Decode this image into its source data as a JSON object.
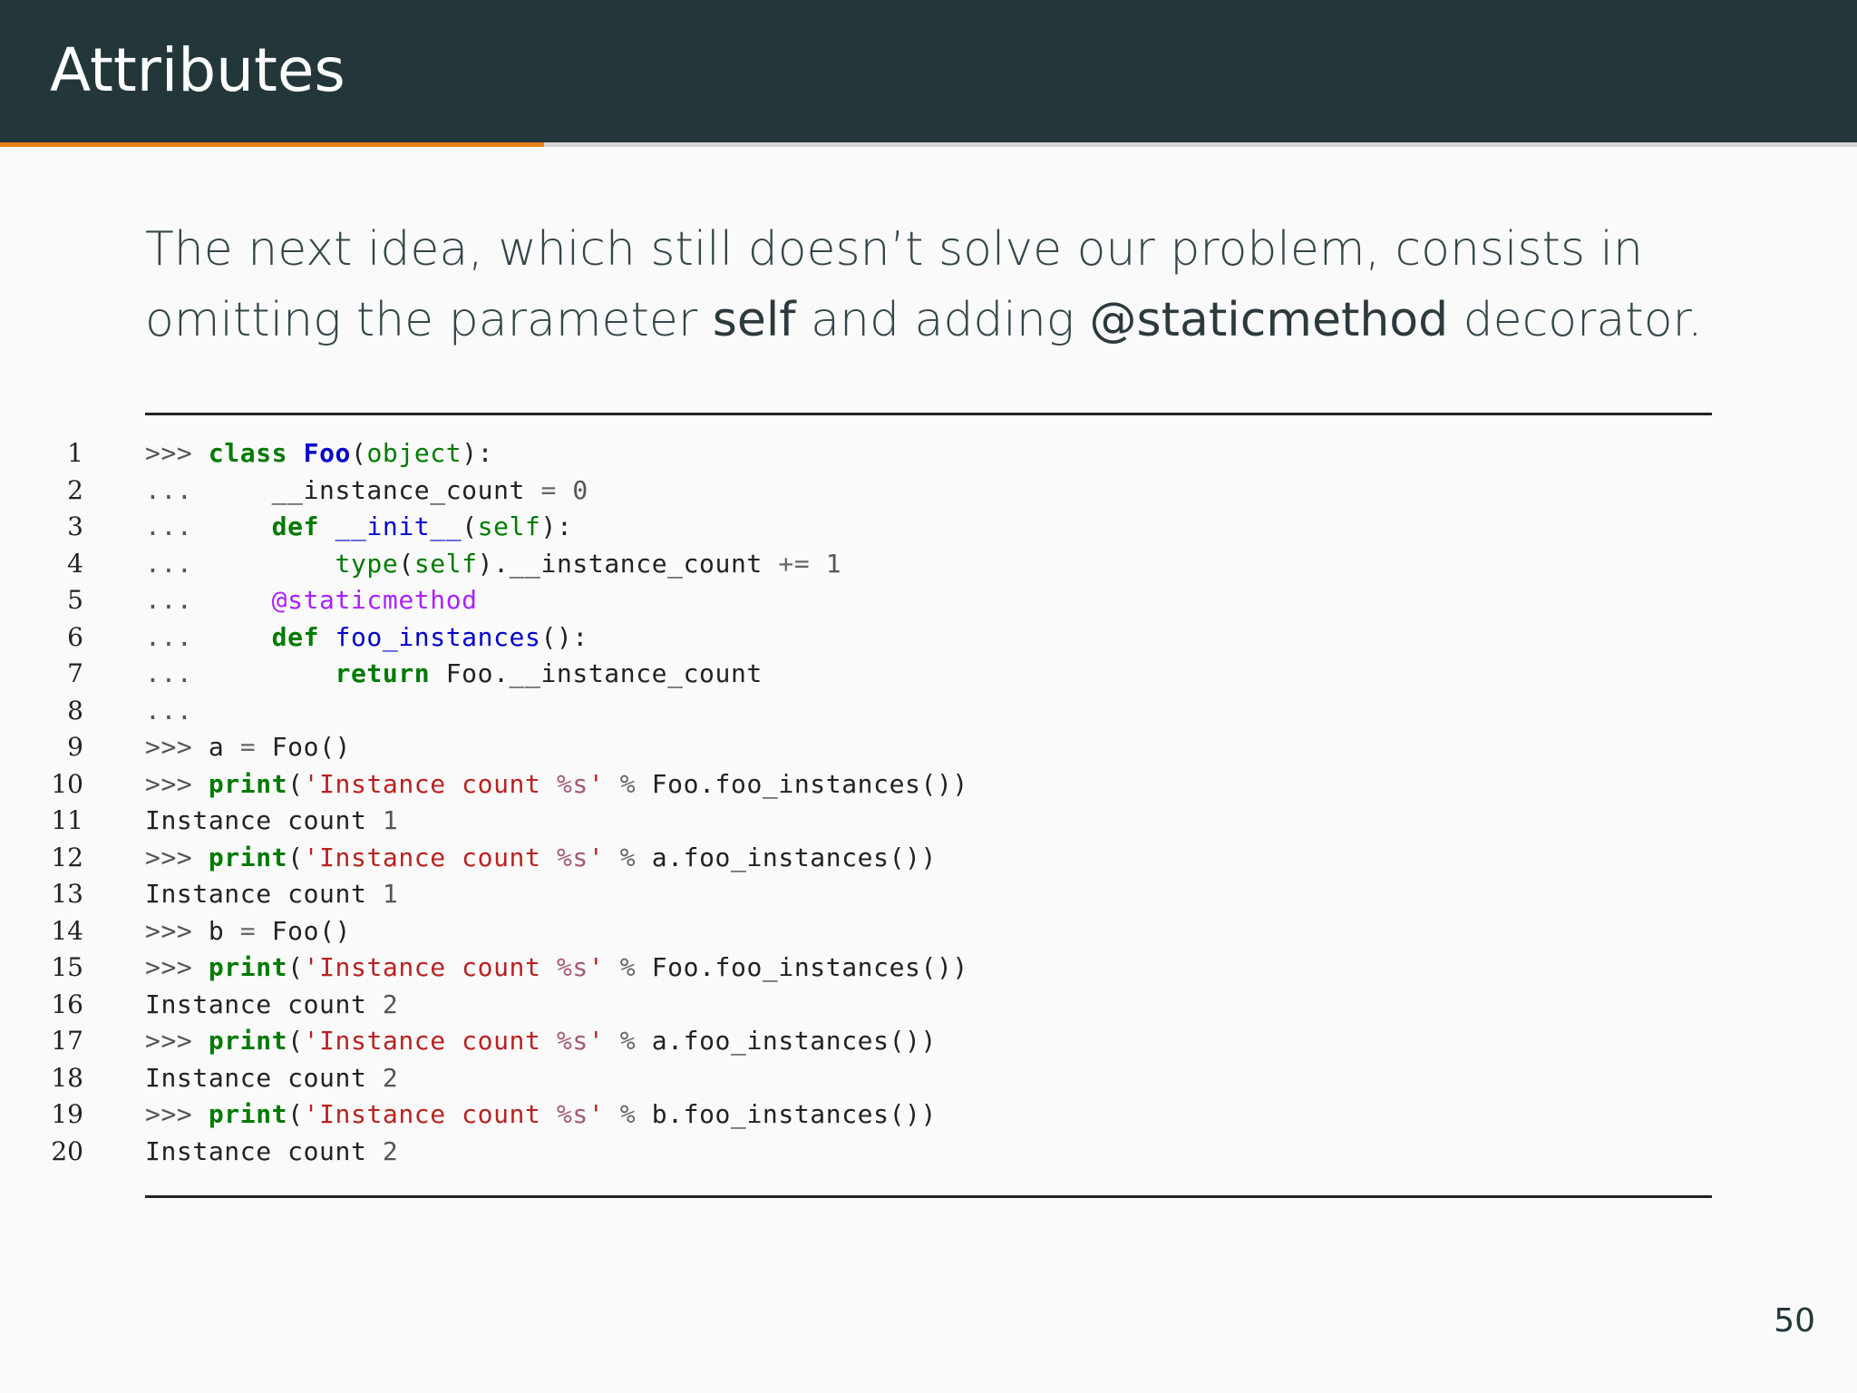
{
  "slide": {
    "title": "Attributes",
    "progress": 0.293,
    "page_number": "50",
    "intro": {
      "part1": "The next idea, which still doesn’t solve our problem, consists in omitting the parameter ",
      "kw1": "self",
      "part2": " and adding ",
      "kw2": "@staticmethod",
      "part3": " decorator."
    }
  },
  "code": {
    "lines": [
      {
        "n": "1",
        "tokens": [
          {
            "t": ">>> ",
            "c": "prompt"
          },
          {
            "t": "class",
            "c": "kw"
          },
          {
            "t": " ",
            "c": "plain"
          },
          {
            "t": "Foo",
            "c": "cls"
          },
          {
            "t": "(",
            "c": "plain"
          },
          {
            "t": "object",
            "c": "bi"
          },
          {
            "t": "):",
            "c": "plain"
          }
        ]
      },
      {
        "n": "2",
        "tokens": [
          {
            "t": "...     ",
            "c": "prompt"
          },
          {
            "t": "__instance_count ",
            "c": "plain"
          },
          {
            "t": "=",
            "c": "op"
          },
          {
            "t": " ",
            "c": "plain"
          },
          {
            "t": "0",
            "c": "num"
          }
        ]
      },
      {
        "n": "3",
        "tokens": [
          {
            "t": "...     ",
            "c": "prompt"
          },
          {
            "t": "def",
            "c": "kw"
          },
          {
            "t": " ",
            "c": "plain"
          },
          {
            "t": "__init__",
            "c": "fn"
          },
          {
            "t": "(",
            "c": "plain"
          },
          {
            "t": "self",
            "c": "bi"
          },
          {
            "t": "):",
            "c": "plain"
          }
        ]
      },
      {
        "n": "4",
        "tokens": [
          {
            "t": "...         ",
            "c": "prompt"
          },
          {
            "t": "type",
            "c": "bi"
          },
          {
            "t": "(",
            "c": "plain"
          },
          {
            "t": "self",
            "c": "bi"
          },
          {
            "t": ").__instance_count ",
            "c": "plain"
          },
          {
            "t": "+=",
            "c": "op"
          },
          {
            "t": " ",
            "c": "plain"
          },
          {
            "t": "1",
            "c": "num"
          }
        ]
      },
      {
        "n": "5",
        "tokens": [
          {
            "t": "...     ",
            "c": "prompt"
          },
          {
            "t": "@staticmethod",
            "c": "deco"
          }
        ]
      },
      {
        "n": "6",
        "tokens": [
          {
            "t": "...     ",
            "c": "prompt"
          },
          {
            "t": "def",
            "c": "kw"
          },
          {
            "t": " ",
            "c": "plain"
          },
          {
            "t": "foo_instances",
            "c": "fn"
          },
          {
            "t": "():",
            "c": "plain"
          }
        ]
      },
      {
        "n": "7",
        "tokens": [
          {
            "t": "...         ",
            "c": "prompt"
          },
          {
            "t": "return",
            "c": "kw"
          },
          {
            "t": " Foo.__instance_count",
            "c": "plain"
          }
        ]
      },
      {
        "n": "8",
        "tokens": [
          {
            "t": "...",
            "c": "prompt"
          }
        ]
      },
      {
        "n": "9",
        "tokens": [
          {
            "t": ">>> ",
            "c": "prompt"
          },
          {
            "t": "a ",
            "c": "plain"
          },
          {
            "t": "=",
            "c": "op"
          },
          {
            "t": " Foo()",
            "c": "plain"
          }
        ]
      },
      {
        "n": "10",
        "tokens": [
          {
            "t": ">>> ",
            "c": "prompt"
          },
          {
            "t": "print",
            "c": "kw"
          },
          {
            "t": "(",
            "c": "plain"
          },
          {
            "t": "'Instance count ",
            "c": "str"
          },
          {
            "t": "%s",
            "c": "fmt"
          },
          {
            "t": "'",
            "c": "str"
          },
          {
            "t": " ",
            "c": "plain"
          },
          {
            "t": "%",
            "c": "op"
          },
          {
            "t": " Foo.foo_instances())",
            "c": "plain"
          }
        ]
      },
      {
        "n": "11",
        "tokens": [
          {
            "t": "Instance count ",
            "c": "plain"
          },
          {
            "t": "1",
            "c": "num"
          }
        ]
      },
      {
        "n": "12",
        "tokens": [
          {
            "t": ">>> ",
            "c": "prompt"
          },
          {
            "t": "print",
            "c": "kw"
          },
          {
            "t": "(",
            "c": "plain"
          },
          {
            "t": "'Instance count ",
            "c": "str"
          },
          {
            "t": "%s",
            "c": "fmt"
          },
          {
            "t": "'",
            "c": "str"
          },
          {
            "t": " ",
            "c": "plain"
          },
          {
            "t": "%",
            "c": "op"
          },
          {
            "t": " a.foo_instances())",
            "c": "plain"
          }
        ]
      },
      {
        "n": "13",
        "tokens": [
          {
            "t": "Instance count ",
            "c": "plain"
          },
          {
            "t": "1",
            "c": "num"
          }
        ]
      },
      {
        "n": "14",
        "tokens": [
          {
            "t": ">>> ",
            "c": "prompt"
          },
          {
            "t": "b ",
            "c": "plain"
          },
          {
            "t": "=",
            "c": "op"
          },
          {
            "t": " Foo()",
            "c": "plain"
          }
        ]
      },
      {
        "n": "15",
        "tokens": [
          {
            "t": ">>> ",
            "c": "prompt"
          },
          {
            "t": "print",
            "c": "kw"
          },
          {
            "t": "(",
            "c": "plain"
          },
          {
            "t": "'Instance count ",
            "c": "str"
          },
          {
            "t": "%s",
            "c": "fmt"
          },
          {
            "t": "'",
            "c": "str"
          },
          {
            "t": " ",
            "c": "plain"
          },
          {
            "t": "%",
            "c": "op"
          },
          {
            "t": " Foo.foo_instances())",
            "c": "plain"
          }
        ]
      },
      {
        "n": "16",
        "tokens": [
          {
            "t": "Instance count ",
            "c": "plain"
          },
          {
            "t": "2",
            "c": "num"
          }
        ]
      },
      {
        "n": "17",
        "tokens": [
          {
            "t": ">>> ",
            "c": "prompt"
          },
          {
            "t": "print",
            "c": "kw"
          },
          {
            "t": "(",
            "c": "plain"
          },
          {
            "t": "'Instance count ",
            "c": "str"
          },
          {
            "t": "%s",
            "c": "fmt"
          },
          {
            "t": "'",
            "c": "str"
          },
          {
            "t": " ",
            "c": "plain"
          },
          {
            "t": "%",
            "c": "op"
          },
          {
            "t": " a.foo_instances())",
            "c": "plain"
          }
        ]
      },
      {
        "n": "18",
        "tokens": [
          {
            "t": "Instance count ",
            "c": "plain"
          },
          {
            "t": "2",
            "c": "num"
          }
        ]
      },
      {
        "n": "19",
        "tokens": [
          {
            "t": ">>> ",
            "c": "prompt"
          },
          {
            "t": "print",
            "c": "kw"
          },
          {
            "t": "(",
            "c": "plain"
          },
          {
            "t": "'Instance count ",
            "c": "str"
          },
          {
            "t": "%s",
            "c": "fmt"
          },
          {
            "t": "'",
            "c": "str"
          },
          {
            "t": " ",
            "c": "plain"
          },
          {
            "t": "%",
            "c": "op"
          },
          {
            "t": " b.foo_instances())",
            "c": "plain"
          }
        ]
      },
      {
        "n": "20",
        "tokens": [
          {
            "t": "Instance count ",
            "c": "plain"
          },
          {
            "t": "2",
            "c": "num"
          }
        ]
      }
    ]
  },
  "colors": {
    "header_bg": "#23373b",
    "progress_accent": "#eb811b",
    "keyword": "#007a00",
    "function_name": "#0000cc",
    "string": "#ba2121",
    "decorator": "#aa22ff"
  }
}
